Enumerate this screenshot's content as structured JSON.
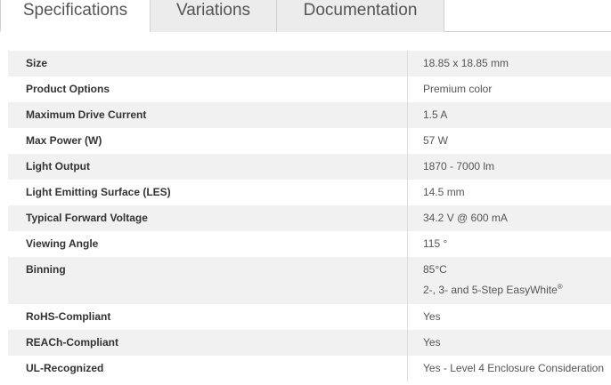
{
  "tabs": [
    {
      "label": "Specifications"
    },
    {
      "label": "Variations"
    },
    {
      "label": "Documentation"
    }
  ],
  "specs": [
    {
      "label": "Size",
      "value": "18.85 x 18.85 mm"
    },
    {
      "label": "Product Options",
      "value": "Premium color"
    },
    {
      "label": "Maximum Drive Current",
      "value": "1.5 A"
    },
    {
      "label": "Max Power (W)",
      "value": "57 W"
    },
    {
      "label": "Light Output",
      "value": "1870 - 7000 lm"
    },
    {
      "label": "Light Emitting Surface (LES)",
      "value": "14.5 mm"
    },
    {
      "label": "Typical Forward Voltage",
      "value": "34.2 V @ 600 mA"
    },
    {
      "label": "Viewing Angle",
      "value": "115 °"
    },
    {
      "label": "Binning",
      "value": "85°C",
      "value2": "2-, 3- and 5-Step EasyWhite",
      "value2_sup": "®"
    },
    {
      "label": "RoHS-Compliant",
      "value": "Yes"
    },
    {
      "label": "REACh-Compliant",
      "value": "Yes"
    },
    {
      "label": "UL-Recognized",
      "value": "Yes - Level 4 Enclosure Consideration"
    }
  ]
}
